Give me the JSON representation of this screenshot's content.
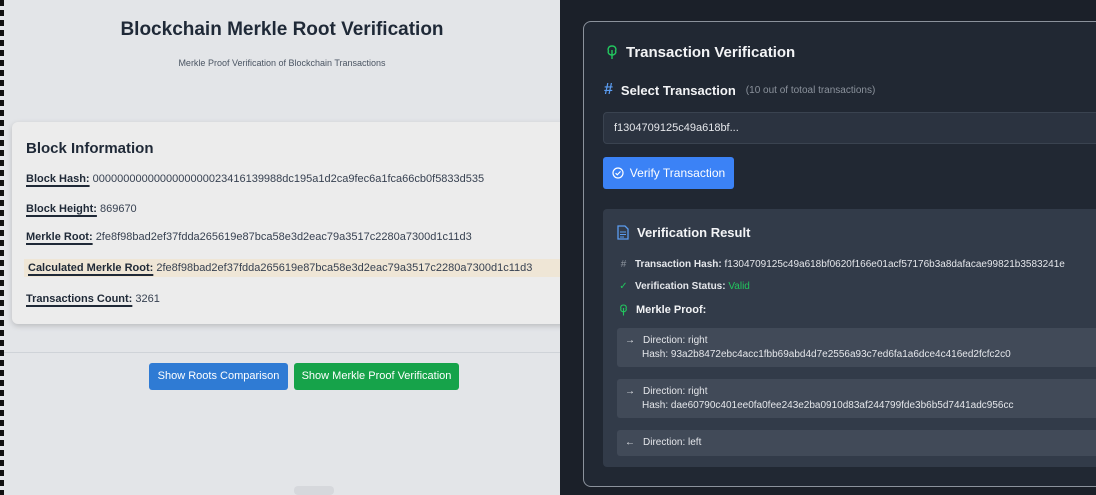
{
  "left": {
    "title": "Blockchain Merkle Root Verification",
    "subtitle": "Merkle Proof Verification of Blockchain Transactions",
    "block_info": {
      "heading": "Block Information",
      "rows": [
        {
          "label": "Block Hash:",
          "value": "0000000000000000000023416139988dc195a1d2ca9fec6a1fca66cb0f5833d535"
        },
        {
          "label": "Block Height:",
          "value": "869670"
        },
        {
          "label": "Merkle Root:",
          "value": "2fe8f98bad2ef37fdda265619e87bca58e3d2eac79a3517c2280a7300d1c11d3"
        },
        {
          "label": "Calculated Merkle Root:",
          "value": "2fe8f98bad2ef37fdda265619e87bca58e3d2eac79a3517c2280a7300d1c11d3"
        },
        {
          "label": "Transactions Count:",
          "value": "3261"
        }
      ]
    },
    "buttons": {
      "roots_comparison": "Show Roots Comparison",
      "merkle_proof": "Show Merkle Proof Verification"
    }
  },
  "right": {
    "panel_title": "Transaction Verification",
    "select_title": "Select Transaction",
    "select_hint": "(10 out of totoal transactions)",
    "selected_tx": "f1304709125c49a618bf...",
    "verify_button": "Verify Transaction",
    "result": {
      "title": "Verification Result",
      "tx_hash_label": "Transaction Hash:",
      "tx_hash_value": "f1304709125c49a618bf0620f166e01acf57176b3a8dafacae99821b3583241e",
      "status_label": "Verification Status:",
      "status_value": "Valid",
      "proof_title": "Merkle Proof:",
      "proof": [
        {
          "direction": "Direction: right",
          "hash": "Hash: 93a2b8472ebc4acc1fbb69abd4d7e2556a93c7ed6fa1a6dce4c416ed2fcfc2c0"
        },
        {
          "direction": "Direction: right",
          "hash": "Hash: dae60790c401ee0fa0fee243e2ba0910d83af244799fde3b6b5d7441adc956cc"
        },
        {
          "direction": "Direction: left",
          "hash": ""
        }
      ]
    }
  },
  "colors": {
    "primary_blue": "#3b82f6",
    "green": "#16a34a",
    "valid": "#22c55e",
    "dark_bg": "#1b2029"
  }
}
